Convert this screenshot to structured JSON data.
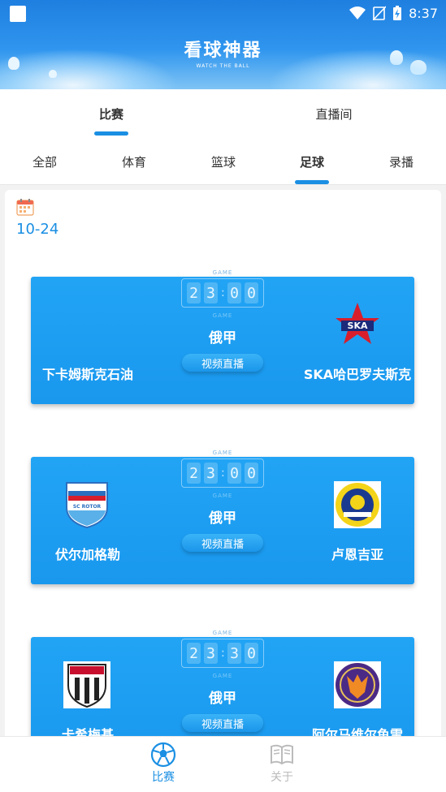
{
  "status_bar": {
    "time": "8:37"
  },
  "header": {
    "title": "看球神器",
    "subtitle": "WATCH THE BALL"
  },
  "top_tabs": [
    {
      "label": "比赛",
      "active": true
    },
    {
      "label": "直播间",
      "active": false
    }
  ],
  "sub_tabs": [
    {
      "label": "全部",
      "active": false
    },
    {
      "label": "体育",
      "active": false
    },
    {
      "label": "篮球",
      "active": false
    },
    {
      "label": "足球",
      "active": true
    },
    {
      "label": "录播",
      "active": false
    }
  ],
  "date": "10-24",
  "matches": [
    {
      "game_label": "GAME",
      "time_digits": [
        "2",
        "3",
        "0",
        "0"
      ],
      "league": "俄甲",
      "live_label": "视频直播",
      "home": "下卡姆斯克石油",
      "away": "SKA哈巴罗夫斯克",
      "away_logo_text": "SKA"
    },
    {
      "game_label": "GAME",
      "time_digits": [
        "2",
        "3",
        "0",
        "0"
      ],
      "league": "俄甲",
      "live_label": "视频直播",
      "home": "伏尔加格勒",
      "away": "卢恩吉亚",
      "home_logo_text": "SC ROTOR"
    },
    {
      "game_label": "GAME",
      "time_digits": [
        "2",
        "3",
        "3",
        "0"
      ],
      "league": "俄甲",
      "live_label": "视频直播",
      "home": "卡希梅基",
      "away": "阿尔马维尔鱼雷"
    }
  ],
  "bottom_nav": [
    {
      "label": "比赛",
      "icon": "soccer-ball-icon",
      "active": true
    },
    {
      "label": "关于",
      "icon": "book-icon",
      "active": false
    }
  ],
  "colors": {
    "accent": "#1a8fe3",
    "card": "#1e9ff2"
  }
}
